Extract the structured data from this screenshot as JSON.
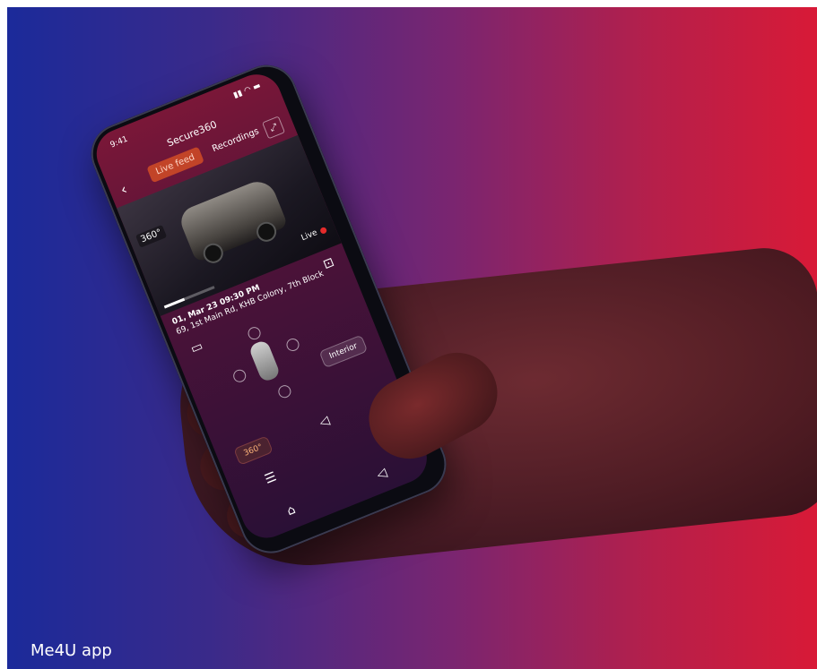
{
  "caption": "Me4U app",
  "phone": {
    "status_time": "9:41",
    "app_title": "Secure360",
    "tabs": [
      {
        "label": "Live feed",
        "active": true
      },
      {
        "label": "Recordings",
        "active": false
      }
    ],
    "feed": {
      "badge": "360°",
      "live_label": "Live",
      "date_time": "01, Mar 23  09:30 PM",
      "address": "69, 1st Main Rd, KHB Colony, 7th Block"
    },
    "buttons": {
      "mode_360": "360°",
      "interior": "Interior"
    }
  },
  "colors": {
    "bg_left": "#1b2a9a",
    "bg_right": "#d81a37",
    "accent": "#c24428",
    "live_dot": "#e52b2b"
  }
}
